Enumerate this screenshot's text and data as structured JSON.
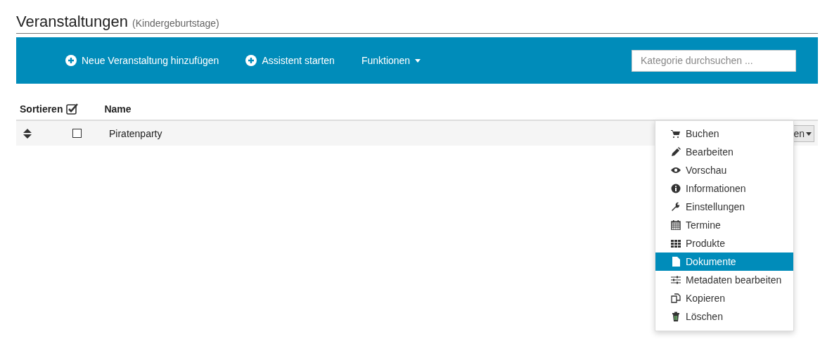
{
  "page": {
    "title": "Veranstaltungen",
    "subtitle": "(Kindergeburtstage)"
  },
  "toolbar": {
    "buttons": [
      {
        "label": "Neue Veranstaltung hinzufügen",
        "kind": "plus"
      },
      {
        "label": "Assistent starten",
        "kind": "plus"
      },
      {
        "label": "Funktionen",
        "kind": "caret"
      }
    ],
    "search": {
      "placeholder": "Kategorie durchsuchen ..."
    }
  },
  "table": {
    "columns": [
      "Sortieren",
      "Name"
    ],
    "select_all": {
      "checked": true
    },
    "rows": [
      {
        "name": "Piratenparty",
        "checked": false,
        "action_button": "en"
      }
    ]
  },
  "menu": {
    "items": [
      {
        "label": "Buchen",
        "selected": false
      },
      {
        "label": "Bearbeiten",
        "selected": false
      },
      {
        "label": "Vorschau",
        "selected": false
      },
      {
        "label": "Informationen",
        "selected": false
      },
      {
        "label": "Einstellungen",
        "selected": false
      },
      {
        "label": "Termine",
        "selected": false
      },
      {
        "label": "Produkte",
        "selected": false
      },
      {
        "label": "Dokumente",
        "selected": true
      },
      {
        "label": "Metadaten bearbeiten",
        "selected": false
      },
      {
        "label": "Kopieren",
        "selected": false
      },
      {
        "label": "Löschen",
        "selected": false
      }
    ]
  }
}
